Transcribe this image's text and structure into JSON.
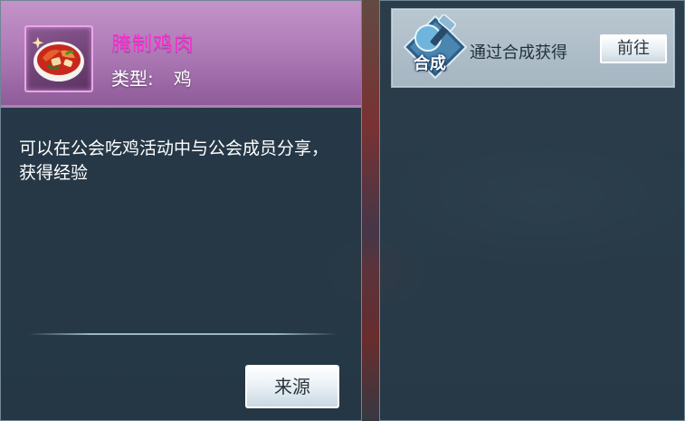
{
  "item": {
    "name": "腌制鸡肉",
    "type_label": "类型:",
    "type_value": "鸡",
    "description": "可以在公会吃鸡活动中与公会成员分享，获得经验",
    "icon": "marinated-chicken-icon",
    "name_color": "#ff2fd6",
    "source_button_label": "来源"
  },
  "source": {
    "entries": [
      {
        "icon": "crafting-hammer-icon",
        "icon_label": "合成",
        "text": "通过合成获得",
        "button_label": "前往"
      }
    ]
  }
}
